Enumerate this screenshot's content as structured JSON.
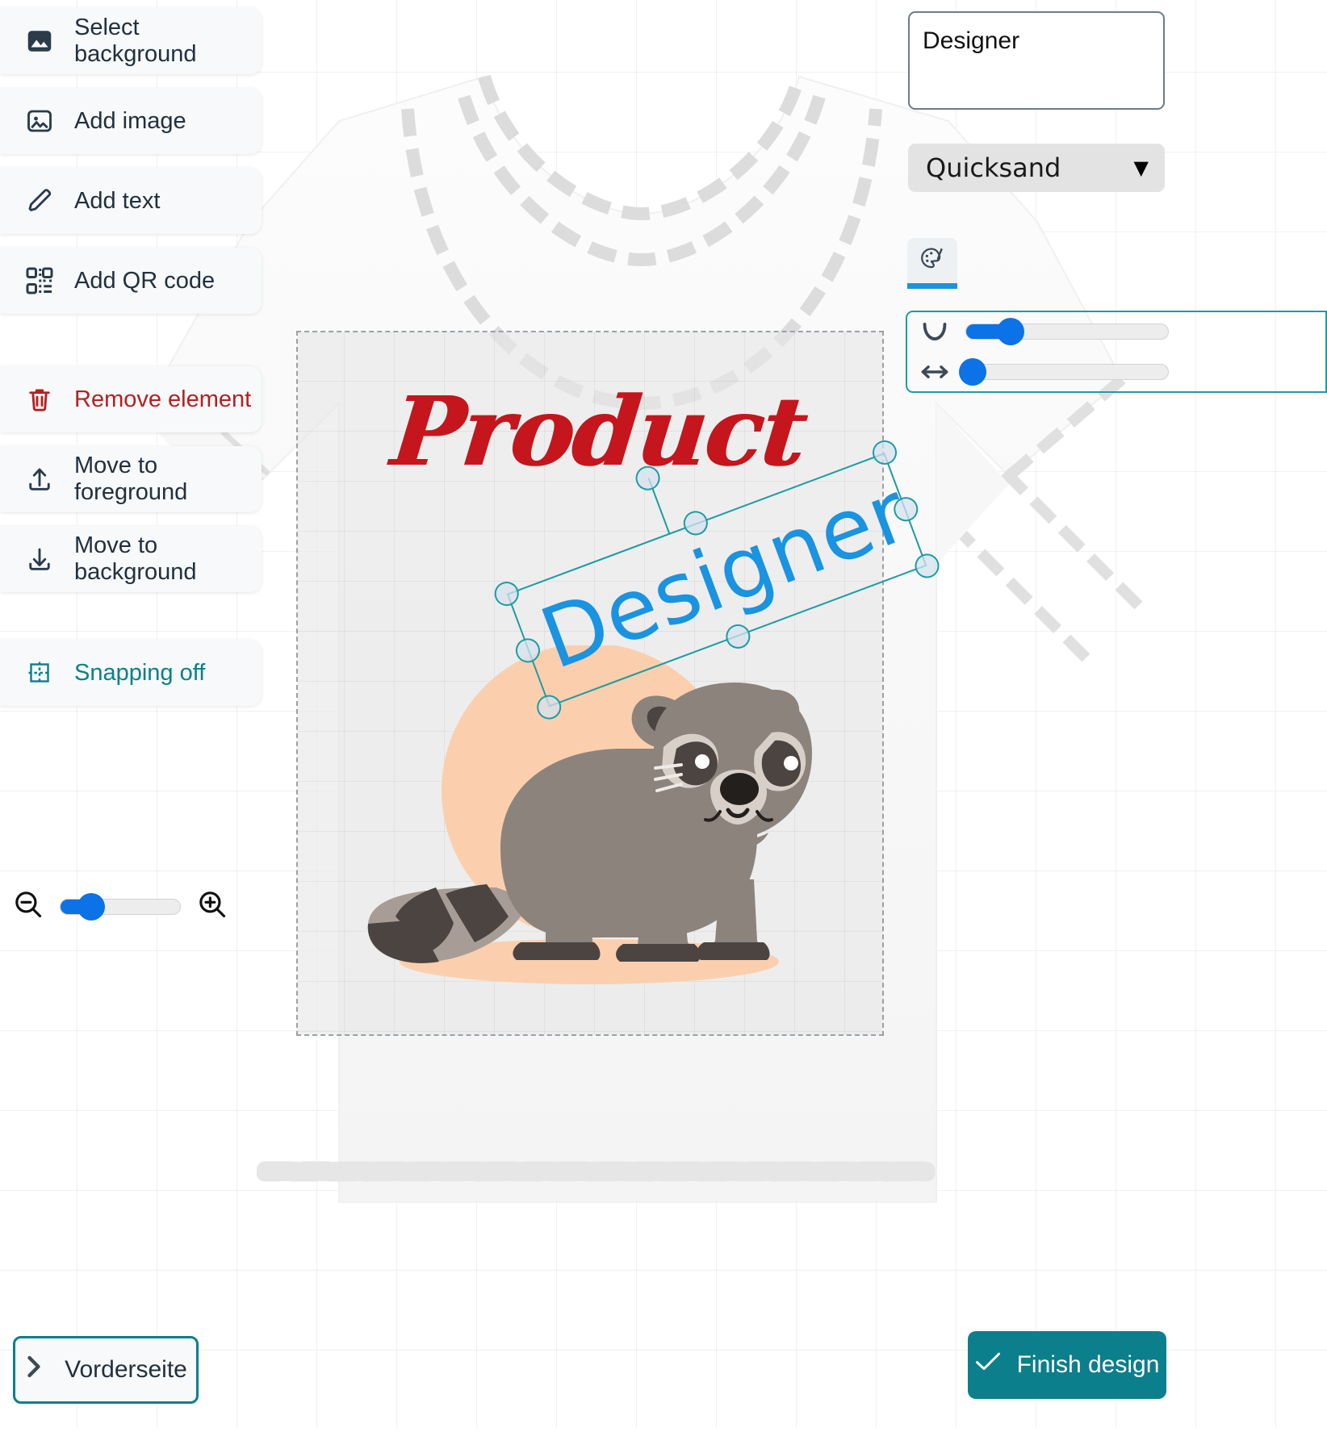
{
  "toolbar": {
    "items": [
      {
        "label": "Select background",
        "icon": "image-mountain-icon",
        "style": "normal"
      },
      {
        "label": "Add image",
        "icon": "add-image-icon",
        "style": "normal"
      },
      {
        "label": "Add text",
        "icon": "pencil-icon",
        "style": "normal"
      },
      {
        "label": "Add QR code",
        "icon": "qr-code-icon",
        "style": "normal"
      },
      {
        "label": "Remove element",
        "icon": "trash-icon",
        "style": "danger"
      },
      {
        "label": "Move to foreground",
        "icon": "upload-arrow-icon",
        "style": "normal"
      },
      {
        "label": "Move to background",
        "icon": "download-arrow-icon",
        "style": "normal"
      },
      {
        "label": "Snapping off",
        "icon": "grid-snap-icon",
        "style": "teal"
      }
    ]
  },
  "zoom_control": {
    "zoom_out_icon": "magnifier-minus-icon",
    "zoom_in_icon": "magnifier-plus-icon",
    "value_percent": 25
  },
  "properties_panel": {
    "text_value": "Designer",
    "text_placeholder": "",
    "font_name": "Quicksand",
    "caret": "▼",
    "tab_icon": "palette-brush-icon",
    "sliders": [
      {
        "name": "text-curve",
        "icon": "curve-arc-icon",
        "value_percent": 22
      },
      {
        "name": "letter-spacing",
        "icon": "horizontal-arrows-icon",
        "value_percent": 3
      }
    ]
  },
  "canvas": {
    "product_text": "Product",
    "designer_text": "Designer",
    "product_color": "#c4161c",
    "designer_color": "#1a93e0",
    "selection_color": "#1d9ca3",
    "artwork": "raccoon-illustration"
  },
  "bottom_bar": {
    "side_label": "Vorderseite",
    "side_icon": "chevron-right-icon",
    "finish_label": "Finish design",
    "finish_icon": "check-icon",
    "finish_color": "#0b7f8c"
  }
}
